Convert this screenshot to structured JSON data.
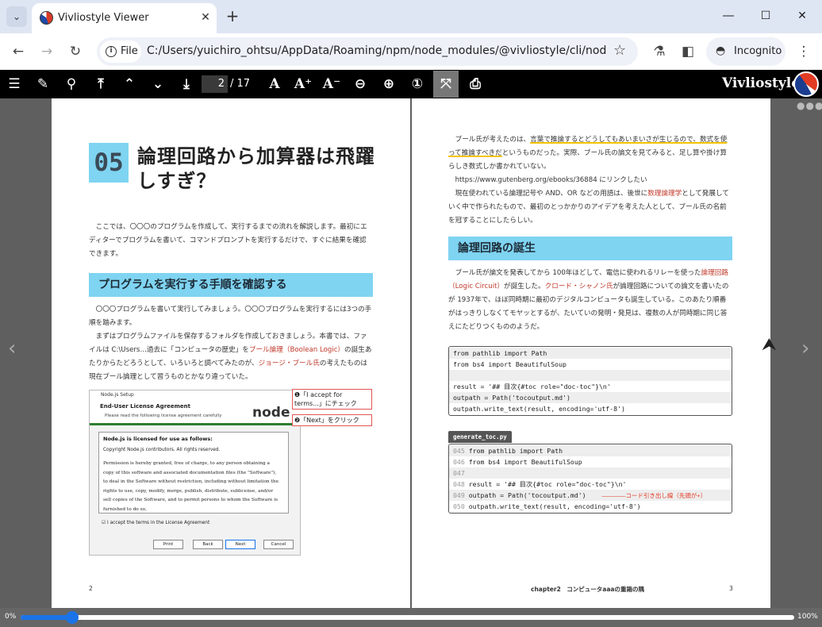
{
  "browser": {
    "tab_title": "Vivliostyle Viewer",
    "chip_label": "File",
    "url": "C:/Users/yuichiro_ohtsu/AppData/Roaming/npm/node_modules/@vivliostyle/cli/node_mod...",
    "incognito_label": "Incognito",
    "icons": [
      "tab-search-icon",
      "close-icon",
      "plus-icon",
      "minimize-icon",
      "maximize-icon",
      "back-icon",
      "forward-icon",
      "reload-icon",
      "info-icon",
      "star-icon",
      "labs-icon",
      "side-panel-icon",
      "incognito-icon",
      "kebab-menu-icon"
    ]
  },
  "toolbar": {
    "page_current": "2",
    "page_total": "/ 17",
    "brand": "Vivliostyle",
    "icons": [
      "toc-icon",
      "marker-icon",
      "search-icon",
      "first-page-icon",
      "prev-page-icon",
      "next-page-icon",
      "last-page-icon",
      "font-size-default-icon",
      "font-size-up-icon",
      "font-size-down-icon",
      "zoom-out-icon",
      "zoom-in-icon",
      "zoom-actual-icon",
      "fit-page-icon",
      "print-icon"
    ]
  },
  "left_page": {
    "chapter_number": "05",
    "chapter_title": "論理回路から加算器は飛躍しすぎ？",
    "intro": "ここでは、〇〇〇のプログラムを作成して、実行するまでの流れを解説します。最初にエディターでプログラムを書いて、コマンドプロンプトを実行するだけで、すぐに結果を確認できます。",
    "heading": "プログラムを実行する手順を確認する",
    "para1": "〇〇〇プログラムを書いて実行してみましょう。〇〇〇プログラムを実行するには3つの手順を踏みます。",
    "para2_a": "まずはプログラムファイルを保存するフォルダを作成しておきましょう。本書では、ファイルは C:\\Users…過去に「コンピュータの歴史」を",
    "para2_kw1": "ブール論理（Boolean Logic）",
    "para2_b": "の誕生あたりからたどろうとして、いろいろと調べてみたのが、",
    "para2_kw2": "ジョージ・ブール氏",
    "para2_c": "の考えたものは現在ブール論理として習うものとかなり違っていた。",
    "screenshot": {
      "window_title": "Node.js Setup",
      "header": "End-User License Agreement",
      "subheader": "Please read the following license agreement carefully",
      "body_title": "Node.js is licensed for use as follows:",
      "copyright": "Copyright Node.js contributors. All rights reserved.",
      "license": "Permission is hereby granted, free of charge, to any person obtaining a copy of this software and associated documentation files (the \"Software\"), to deal in the Software without restriction, including without limitation the rights to use, copy, modify, merge, publish, distribute, sublicense, and/or sell copies of the Software, and to permit persons to whom the Software is furnished to do so,",
      "checkbox": "I accept the terms in the License Agreement",
      "buttons": [
        "Print",
        "Back",
        "Next",
        "Cancel"
      ],
      "logo": "node"
    },
    "callout1": "❶「I accept for terms...」にチェック",
    "callout2": "❷「Next」をクリック",
    "folio": "2"
  },
  "right_page": {
    "p1_a": "ブール氏が考えたのは、",
    "p1_hl": "言葉で推論するとどうしてもあいまいさが生じるので、数式を使って推論すべきだ",
    "p1_b": "というものだった。実際、ブール氏の論文を見てみると、足し算や掛け算らしき数式しか書かれていない。",
    "p1_link": "https://www.gutenberg.org/ebooks/36884 にリンクしたい",
    "p2_a": "現在使われている論理記号や AND、OR などの用語は、後世に",
    "p2_kw": "数理論理学",
    "p2_b": "として発展していく中で作られたもので、最初のとっかかりのアイデアを考えた人として、ブール氏の名前を冠することにしたらしい。",
    "heading": "論理回路の誕生",
    "p3_a": "ブール氏が論文を発表してから 100年ほどして、電信に使われるリレーを使った",
    "p3_kw1": "論理回路（Logic Circuit）",
    "p3_b": "が誕生した。",
    "p3_kw2": "クロード・シャノン氏",
    "p3_c": "が論理回路についての論文を書いたのが 1937年で、ほぼ同時期に最初のデジタルコンピュータも誕生している。このあたり順番がはっきりしなくてモヤッとするが、たいていの発明・発見は、複数の人が同時期に同じ答えにたどりつくもののようだ。",
    "code1": [
      "from pathlib import Path",
      "from bs4 import BeautifulSoup",
      "",
      "result = '## 目次{#toc role=\"doc-toc\"}\\n'",
      "outpath = Path('tocoutput.md')",
      "outpath.write_text(result, encoding='utf-8')"
    ],
    "code2_filename": "generate_toc.py",
    "code2": [
      {
        "no": "045",
        "text": " from pathlib import Path"
      },
      {
        "no": "046",
        "text": " from bs4 import BeautifulSoup"
      },
      {
        "no": "047",
        "text": ""
      },
      {
        "no": "048",
        "text": " result = '## 目次{#toc role=\"doc-toc\"}\\n'"
      },
      {
        "no": "049",
        "text": " outpath = Path('tocoutput.md')"
      },
      {
        "no": "050",
        "text": " outpath.write_text(result, encoding='utf-8')"
      }
    ],
    "code2_note": "――――コード引き出し線（先頭が+）",
    "running_head": "chapter2　コンピュータaaaの重箱の隅",
    "folio": "3"
  },
  "status": {
    "zoom_min": "0%",
    "zoom_max": "100%",
    "position": 0.067
  },
  "colors": {
    "accent": "#1a73e8",
    "heading_bg": "#7fd4f1",
    "keyword": "#c0392b",
    "highlight": "#f3c300"
  }
}
